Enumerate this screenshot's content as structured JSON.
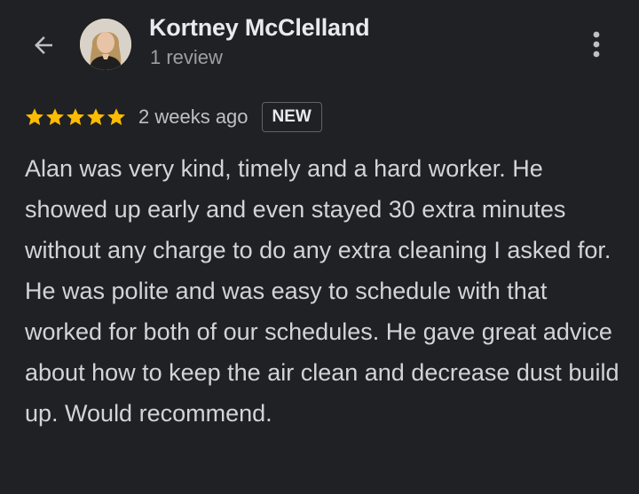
{
  "header": {
    "back_icon": "arrow-back-icon",
    "reviewer_name": "Kortney McClelland",
    "review_count": "1 review",
    "more_icon": "more-vert-icon"
  },
  "review": {
    "rating": 5,
    "max_rating": 5,
    "star_color": "#fbbc04",
    "date": "2 weeks ago",
    "badge": "NEW",
    "text": "Alan was very kind, timely and a hard worker. He showed up early and even stayed 30 extra minutes without any charge to do any extra cleaning I asked for. He was polite and was easy to schedule with that worked for both of our schedules. He gave great advice about how to keep the air clean and decrease dust build up. Would recommend."
  },
  "theme": {
    "background": "#202124",
    "primary_text": "#e8eaed",
    "secondary_text": "#9aa0a6"
  }
}
